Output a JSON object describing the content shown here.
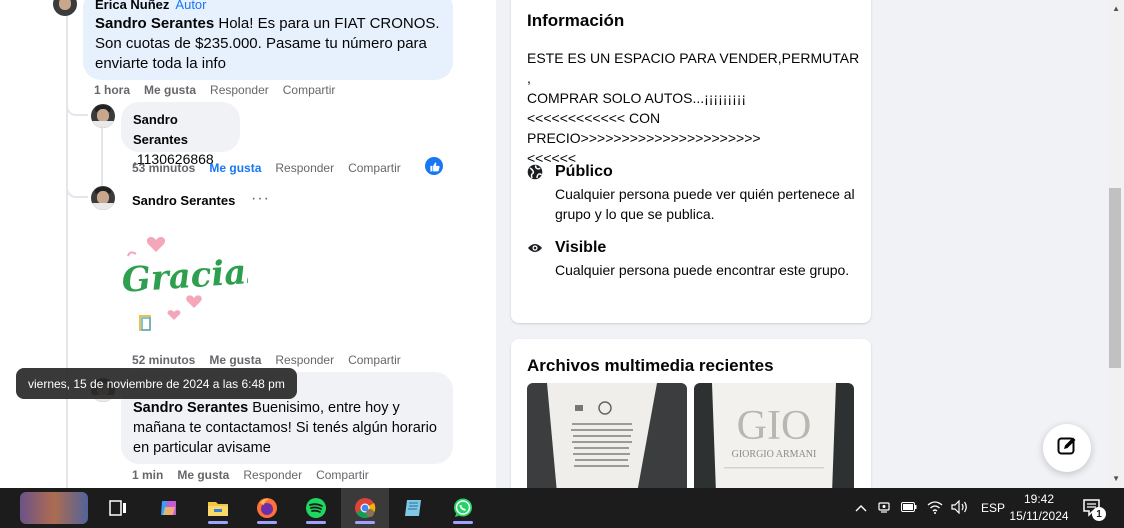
{
  "comments": {
    "c1": {
      "author_partial": "Erica Nuñez",
      "author_badge": "Autor",
      "mention": "Sandro Serantes",
      "text": " Hola! Es para un FIAT CRONOS. Son cuotas de $235.000. Pasame tu número para enviarte toda la info",
      "time": "1 hora",
      "like": "Me gusta",
      "reply": "Responder",
      "share": "Compartir"
    },
    "c2": {
      "author": "Sandro Serantes",
      "text": ",1130626868",
      "time": "53 minutos",
      "like": "Me gusta",
      "reply": "Responder",
      "share": "Compartir"
    },
    "c3": {
      "author": "Sandro Serantes",
      "more": "···",
      "sticker_text": "Gracias",
      "time": "52 minutos",
      "like": "Me gusta",
      "reply": "Responder",
      "share": "Compartir"
    },
    "c4": {
      "mention": "Sandro Serantes",
      "text": " Buenisimo, entre hoy y mañana te contactamos! Si tenés algún horario en particular avisame",
      "time": "1 min",
      "like": "Me gusta",
      "reply": "Responder",
      "share": "Compartir"
    }
  },
  "tooltip": "viernes, 15 de noviembre de 2024 a las 6:48 pm",
  "info": {
    "title": "Información",
    "description": "ESTE ES UN ESPACIO PARA VENDER,PERMUTAR ,\nCOMPRAR SOLO AUTOS...¡¡¡¡¡¡¡¡¡\n<<<<<<<<<<<< CON\nPRECIO>>>>>>>>>>>>>>>>>>>>>>\n<<<<<<",
    "public_title": "Público",
    "public_desc": "Cualquier persona puede ver quién pertenece al grupo y lo que se publica.",
    "visible_title": "Visible",
    "visible_desc": "Cualquier persona puede encontrar este grupo."
  },
  "media": {
    "title": "Archivos multimedia recientes",
    "thumb2_text": "GIO",
    "thumb2_sub": "GIORGIO ARMANI"
  },
  "taskbar": {
    "lang": "ESP",
    "time": "19:42",
    "date": "15/11/2024",
    "notif_count": "1"
  },
  "colors": {
    "accent": "#1877f2",
    "bubble": "#f0f2f5",
    "bubble_highlight": "#e7f0fd"
  }
}
